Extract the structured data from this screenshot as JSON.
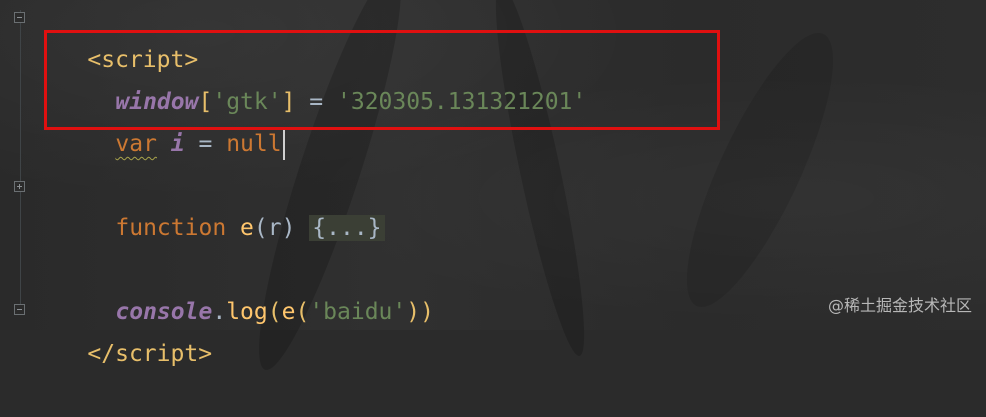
{
  "editor": {
    "lines": {
      "script_open": {
        "open_bracket": "<",
        "tag": "script",
        "close_bracket": ">"
      },
      "window_line": {
        "object": "window",
        "bracket_open": "[",
        "key": "'gtk'",
        "bracket_close": "]",
        "operator": " = ",
        "value": "'320305.131321201'"
      },
      "var_line": {
        "keyword": "var",
        "name": "i",
        "operator": " = ",
        "value": "null"
      },
      "function_line": {
        "keyword": "function",
        "name": "e",
        "params": "(r)",
        "folded": "{...}"
      },
      "console_line": {
        "object": "console",
        "dot": ".",
        "method": "log",
        "paren_open": "(",
        "inner_call": "e",
        "inner_open": "(",
        "argument": "'baidu'",
        "inner_close": ")",
        "paren_close": ")"
      },
      "script_close": {
        "open_bracket": "</",
        "tag": "script",
        "close_bracket": ">"
      }
    }
  },
  "watermark": "@稀土掘金技术社区",
  "colors": {
    "background": "#2b2b2b",
    "highlight_border": "#e01010",
    "tag": "#e8bf6a",
    "string": "#6a8759",
    "keyword": "#cc7832",
    "italic_global": "#9876aa"
  }
}
